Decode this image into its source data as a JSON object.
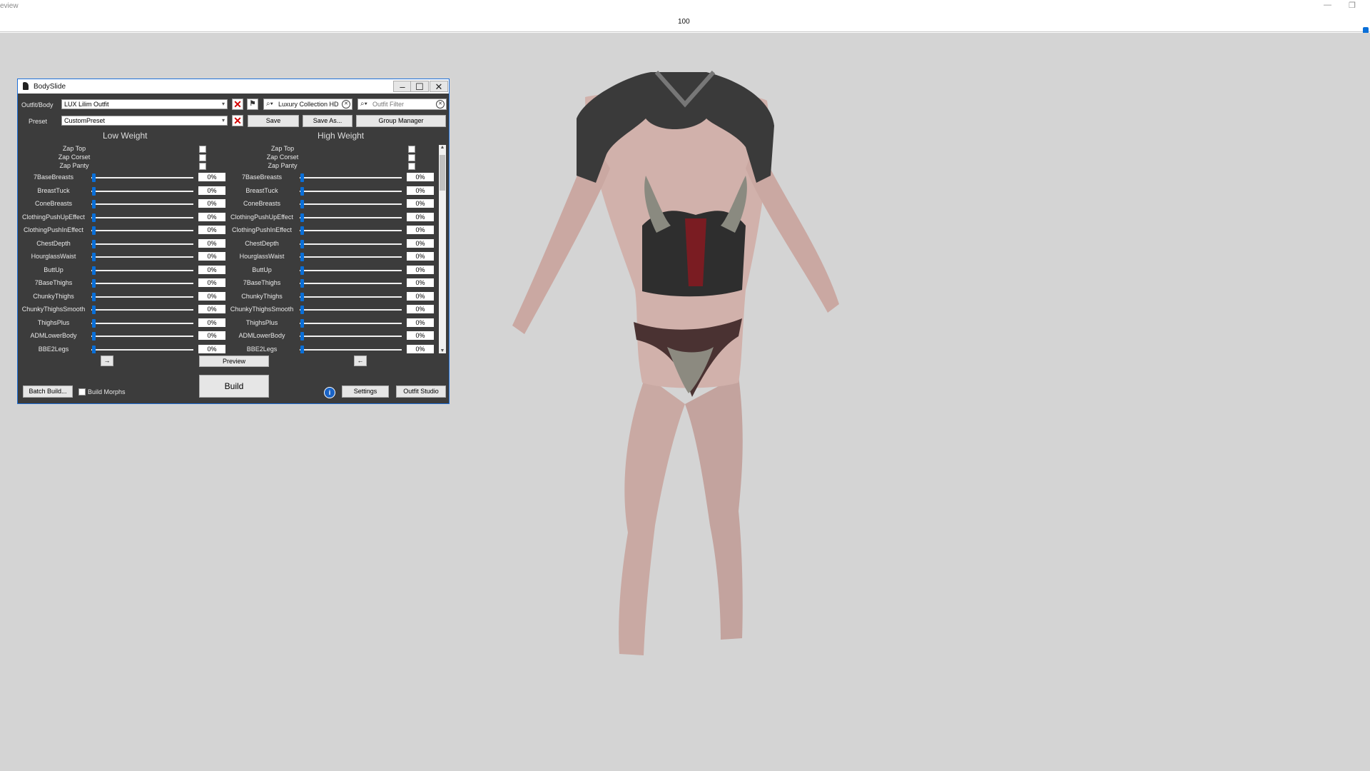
{
  "preview_window": {
    "title_fragment": "eview",
    "zoom_value": "100",
    "zoom_level": 1.0
  },
  "bodyslide": {
    "title": "BodySlide",
    "outfit_label": "Outfit/Body",
    "outfit_value": "LUX Lilim Outfit",
    "preset_label": "Preset",
    "preset_value": "CustomPreset",
    "group_filter": "Luxury Collection HD",
    "outfit_filter_placeholder": "Outfit Filter",
    "save_label": "Save",
    "save_as_label": "Save As...",
    "group_manager_label": "Group Manager",
    "low_weight_label": "Low Weight",
    "high_weight_label": "High Weight",
    "zaps": [
      "Zap Top",
      "Zap Corset",
      "Zap Panty"
    ],
    "sliders": [
      {
        "name": "7BaseBreasts",
        "low": "0%",
        "high": "0%"
      },
      {
        "name": "BreastTuck",
        "low": "0%",
        "high": "0%"
      },
      {
        "name": "ConeBreasts",
        "low": "0%",
        "high": "0%"
      },
      {
        "name": "ClothingPushUpEffect",
        "low": "0%",
        "high": "0%"
      },
      {
        "name": "ClothingPushInEffect",
        "low": "0%",
        "high": "0%"
      },
      {
        "name": "ChestDepth",
        "low": "0%",
        "high": "0%"
      },
      {
        "name": "HourglassWaist",
        "low": "0%",
        "high": "0%"
      },
      {
        "name": "ButtUp",
        "low": "0%",
        "high": "0%"
      },
      {
        "name": "7BaseThighs",
        "low": "0%",
        "high": "0%"
      },
      {
        "name": "ChunkyThighs",
        "low": "0%",
        "high": "0%"
      },
      {
        "name": "ChunkyThighsSmooth",
        "low": "0%",
        "high": "0%"
      },
      {
        "name": "ThighsPlus",
        "low": "0%",
        "high": "0%"
      },
      {
        "name": "ADMLowerBody",
        "low": "0%",
        "high": "0%"
      },
      {
        "name": "BBE2Legs",
        "low": "0%",
        "high": "0%"
      }
    ],
    "copy_right_arrow": "→",
    "copy_left_arrow": "←",
    "preview_label": "Preview",
    "build_label": "Build",
    "batch_build_label": "Batch Build...",
    "build_morphs_label": "Build Morphs",
    "settings_label": "Settings",
    "outfit_studio_label": "Outfit Studio",
    "info_icon": "i"
  },
  "colors": {
    "accent": "#0a6fd8",
    "panel": "#3c3c3c",
    "viewport": "#d4d4d4",
    "delete": "#d40000"
  }
}
